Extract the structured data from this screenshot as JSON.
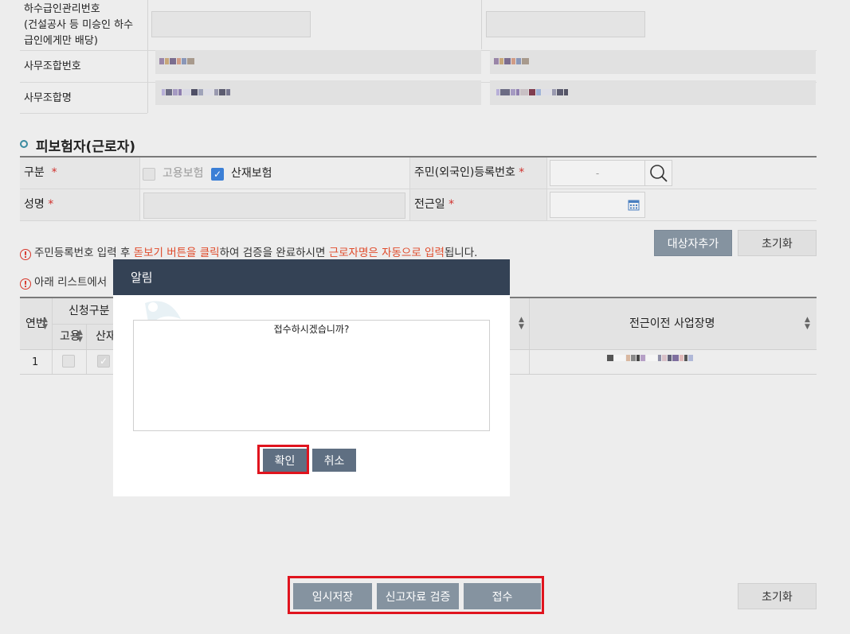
{
  "top_table": {
    "row1_label": "하수급인관리번호\n(건설공사 등 미승인 하수\n급인에게만 배당)",
    "row2_label": "사무조합번호",
    "row3_label": "사무조합명"
  },
  "section": {
    "title": "피보험자(근로자)"
  },
  "form": {
    "category_label": "구분",
    "required_mark": "*",
    "employment_insurance_label": "고용보험",
    "industrial_insurance_label": "산재보험",
    "resident_number_label": "주민(외국인)등록번호",
    "resident_number_separator": "-",
    "name_label": "성명",
    "transfer_date_label": "전근일"
  },
  "buttons": {
    "add_target": "대상자추가",
    "reset_top": "초기화",
    "temp_save": "임시저장",
    "verify": "신고자료 검증",
    "submit": "접수",
    "reset_bottom": "초기화"
  },
  "notices": {
    "notice1_part1": "주민등록번호 입력 후 ",
    "notice1_em1": "돋보기 버튼을 클릭",
    "notice1_part2": "하여 검증을 완료하시면 ",
    "notice1_em2": "근로자명은 자동으로 입력",
    "notice1_part3": "됩니다.",
    "notice2_part1": "아래 리스트에서"
  },
  "list_table": {
    "col_no": "연번",
    "col_apply_type": "신청구분",
    "col_employment": "고용",
    "col_industrial": "산재",
    "col_prev_workplace": "전근이전 사업장명",
    "rows": [
      {
        "no": "1"
      }
    ]
  },
  "modal": {
    "title": "알림",
    "message": "접수하시겠습니까?",
    "confirm": "확인",
    "cancel": "취소"
  },
  "colors": {
    "modal_header": "#344255",
    "highlight_red": "#e0141e",
    "accent_teal": "#3a8ba0",
    "required_red": "#d0312d"
  }
}
